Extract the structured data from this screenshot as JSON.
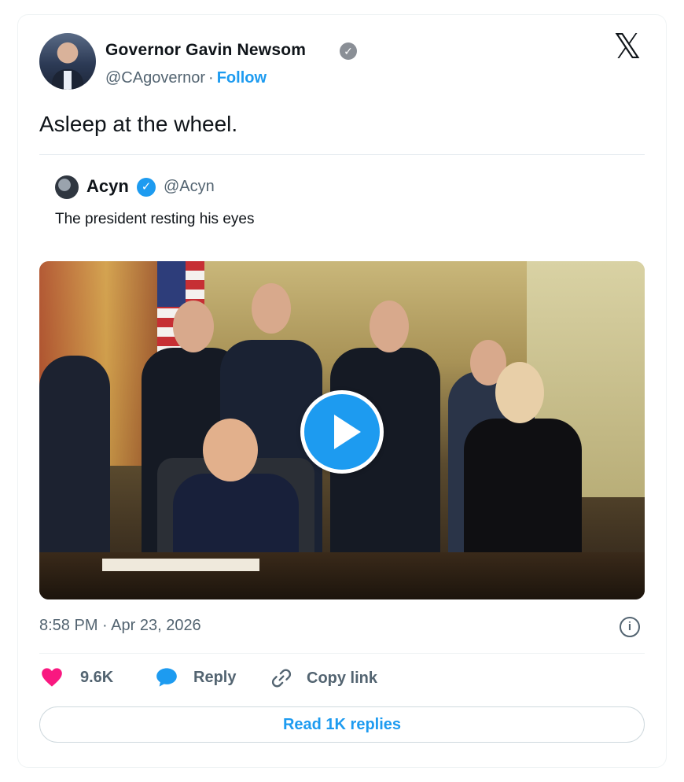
{
  "author": {
    "name": "Governor Gavin Newsom",
    "handle": "@CAgovernor",
    "separator": "·",
    "follow_label": "Follow",
    "verified_icon": "verified-gray-check-icon",
    "avatar_icon": "avatar"
  },
  "brand_icon": "x-logo-icon",
  "tweet": {
    "text": "Asleep at the wheel."
  },
  "quoted": {
    "name": "Acyn",
    "handle": "@Acyn",
    "text": "The president resting his eyes",
    "verified_icon": "verified-blue-check-icon"
  },
  "media": {
    "type": "video",
    "play_icon": "play-icon"
  },
  "meta": {
    "timestamp": "8:58 PM · Apr 23, 2026",
    "info_icon": "info-icon"
  },
  "actions": {
    "likes": "9.6K",
    "reply_label": "Reply",
    "copy_link_label": "Copy link"
  },
  "read_replies_label": "Read 1K replies",
  "colors": {
    "accent": "#1d9bf0",
    "like": "#f91880",
    "text": "#0f1419",
    "secondary": "#536471"
  }
}
